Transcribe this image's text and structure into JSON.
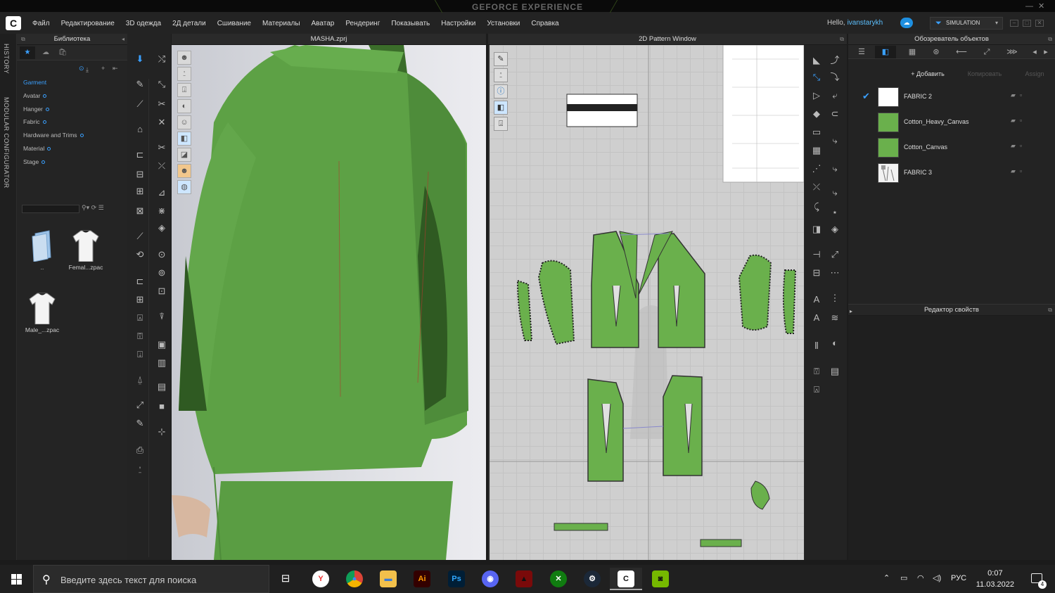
{
  "geforce": {
    "title": "GEFORCE EXPERIENCE"
  },
  "menu": [
    "Файл",
    "Редактирование",
    "3D одежда",
    "2Д детали",
    "Сшивание",
    "Материалы",
    "Аватар",
    "Рендеринг",
    "Показывать",
    "Настройки",
    "Установки",
    "Справка"
  ],
  "user": {
    "greeting": "Hello,",
    "name": "ivanstarykh"
  },
  "mode": {
    "label": "SIMULATION"
  },
  "side_tabs": {
    "history": "HISTORY",
    "modular": "MODULAR CONFIGURATOR"
  },
  "library": {
    "title": "Библиотека",
    "tree": [
      "Garment",
      "Avatar",
      "Hanger",
      "Fabric",
      "Hardware and Trims",
      "Material",
      "Stage"
    ],
    "thumbs": [
      {
        "label": "..",
        "icon": "folder-icon"
      },
      {
        "label": "Femal...zpac",
        "icon": "tshirt-icon"
      },
      {
        "label": "Male_...zpac",
        "icon": "tshirt-icon"
      }
    ]
  },
  "viewport3d": {
    "title": "MASHA.zprj"
  },
  "pattern2d": {
    "title": "2D Pattern Window"
  },
  "object_browser": {
    "title": "Обозреватель объектов",
    "add": "+ Добавить",
    "copy": "Копировать",
    "assign": "Assign",
    "fabrics": [
      {
        "name": "FABRIC 2",
        "checked": true,
        "swatch": "white"
      },
      {
        "name": "Cotton_Heavy_Canvas",
        "checked": false,
        "swatch": "#6ab04c"
      },
      {
        "name": "Cotton_Canvas",
        "checked": false,
        "swatch": "#6ab04c"
      },
      {
        "name": "FABRIC 3",
        "checked": false,
        "swatch": "sketch"
      }
    ]
  },
  "property_editor": {
    "title": "Редактор свойств"
  },
  "taskbar": {
    "search_placeholder": "Введите здесь текст для поиска",
    "lang": "РУС",
    "time": "0:07",
    "date": "11.03.2022",
    "notifications": "4"
  },
  "colors": {
    "accent": "#3aa0ff",
    "garment": "#5fa84a",
    "pattern_fill": "#6ab04c"
  }
}
